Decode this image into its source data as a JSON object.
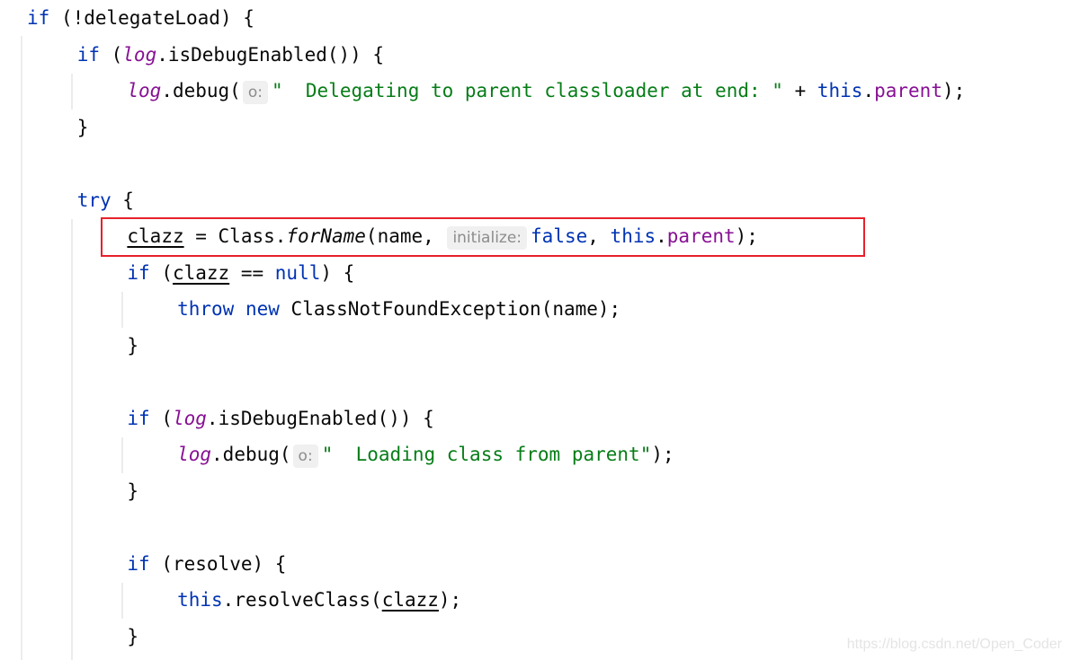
{
  "editor": {
    "lines": [
      {
        "indent": 0,
        "tokens": [
          {
            "t": "if",
            "c": "kw"
          },
          {
            "t": " (!delegateLoad) {"
          }
        ]
      },
      {
        "indent": 1,
        "tokens": [
          {
            "t": "if",
            "c": "kw"
          },
          {
            "t": " ("
          },
          {
            "t": "log",
            "c": "fld ital"
          },
          {
            "t": ".isDebugEnabled()) {"
          }
        ]
      },
      {
        "indent": 2,
        "tokens": [
          {
            "t": "log",
            "c": "fld ital"
          },
          {
            "t": ".debug("
          },
          {
            "t": "o:",
            "c": "hint"
          },
          {
            "t": "\"  Delegating to parent classloader at end: \"",
            "c": "str"
          },
          {
            "t": " + "
          },
          {
            "t": "this",
            "c": "kw"
          },
          {
            "t": "."
          },
          {
            "t": "parent",
            "c": "fld"
          },
          {
            "t": ");"
          }
        ]
      },
      {
        "indent": 1,
        "tokens": [
          {
            "t": "}"
          }
        ]
      },
      {
        "indent": 0,
        "tokens": []
      },
      {
        "indent": 1,
        "tokens": [
          {
            "t": "try",
            "c": "kw"
          },
          {
            "t": " {"
          }
        ]
      },
      {
        "indent": 2,
        "tokens": [
          {
            "t": "clazz",
            "c": "ul"
          },
          {
            "t": " = Class."
          },
          {
            "t": "forName",
            "c": "ital"
          },
          {
            "t": "(name, "
          },
          {
            "t": "initialize:",
            "c": "hint"
          },
          {
            "t": "false",
            "c": "kw"
          },
          {
            "t": ", "
          },
          {
            "t": "this",
            "c": "kw"
          },
          {
            "t": "."
          },
          {
            "t": "parent",
            "c": "fld"
          },
          {
            "t": ");"
          }
        ]
      },
      {
        "indent": 2,
        "tokens": [
          {
            "t": "if",
            "c": "kw"
          },
          {
            "t": " ("
          },
          {
            "t": "clazz",
            "c": "ul"
          },
          {
            "t": " == "
          },
          {
            "t": "null",
            "c": "kw"
          },
          {
            "t": ") {"
          }
        ]
      },
      {
        "indent": 3,
        "tokens": [
          {
            "t": "throw",
            "c": "kw"
          },
          {
            "t": " "
          },
          {
            "t": "new",
            "c": "kw"
          },
          {
            "t": " ClassNotFoundException(name);"
          }
        ]
      },
      {
        "indent": 2,
        "tokens": [
          {
            "t": "}"
          }
        ]
      },
      {
        "indent": 0,
        "tokens": []
      },
      {
        "indent": 2,
        "tokens": [
          {
            "t": "if",
            "c": "kw"
          },
          {
            "t": " ("
          },
          {
            "t": "log",
            "c": "fld ital"
          },
          {
            "t": ".isDebugEnabled()) {"
          }
        ]
      },
      {
        "indent": 3,
        "tokens": [
          {
            "t": "log",
            "c": "fld ital"
          },
          {
            "t": ".debug("
          },
          {
            "t": "o:",
            "c": "hint"
          },
          {
            "t": "\"  Loading class from parent\"",
            "c": "str"
          },
          {
            "t": ");"
          }
        ]
      },
      {
        "indent": 2,
        "tokens": [
          {
            "t": "}"
          }
        ]
      },
      {
        "indent": 0,
        "tokens": []
      },
      {
        "indent": 2,
        "tokens": [
          {
            "t": "if",
            "c": "kw"
          },
          {
            "t": " (resolve) {"
          }
        ]
      },
      {
        "indent": 3,
        "tokens": [
          {
            "t": "this",
            "c": "kw"
          },
          {
            "t": ".resolveClass("
          },
          {
            "t": "clazz",
            "c": "ul"
          },
          {
            "t": ");"
          }
        ]
      },
      {
        "indent": 2,
        "tokens": [
          {
            "t": "}"
          }
        ]
      }
    ]
  },
  "highlight_color": "#e8202a",
  "watermark": "https://blog.csdn.net/Open_Coder"
}
